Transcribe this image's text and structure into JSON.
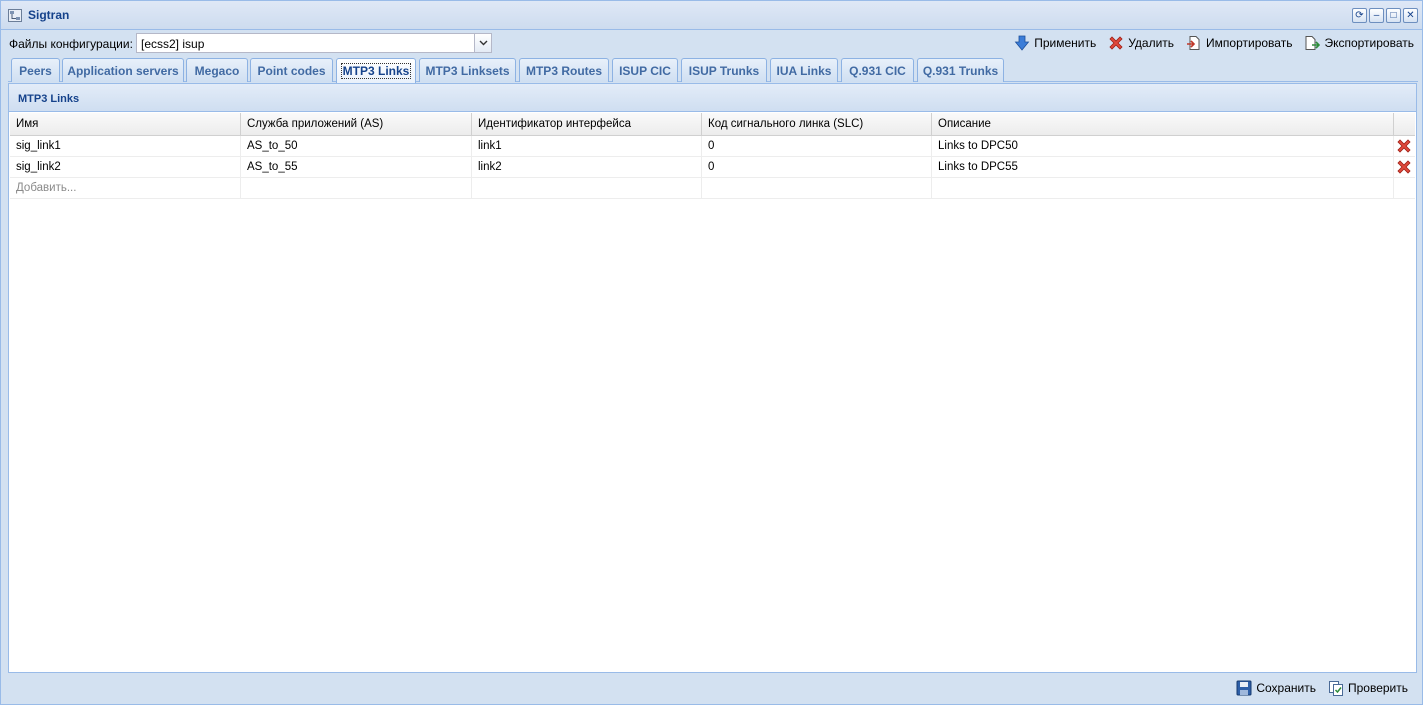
{
  "window": {
    "title": "Sigtran",
    "tools": [
      "refresh-icon",
      "minimize-icon",
      "maximize-icon",
      "close-icon"
    ]
  },
  "toolbar": {
    "config_label": "Файлы конфигурации:",
    "config_value": "[ecss2] isup",
    "apply": "Применить",
    "delete": "Удалить",
    "import": "Импортировать",
    "export": "Экспортировать"
  },
  "tabs": [
    {
      "label": "Peers",
      "active": false
    },
    {
      "label": "Application servers",
      "active": false
    },
    {
      "label": "Megaco",
      "active": false
    },
    {
      "label": "Point codes",
      "active": false
    },
    {
      "label": "MTP3 Links",
      "active": true
    },
    {
      "label": "MTP3 Linksets",
      "active": false
    },
    {
      "label": "MTP3 Routes",
      "active": false
    },
    {
      "label": "ISUP CIC",
      "active": false
    },
    {
      "label": "ISUP Trunks",
      "active": false
    },
    {
      "label": "IUA Links",
      "active": false
    },
    {
      "label": "Q.931 CIC",
      "active": false
    },
    {
      "label": "Q.931 Trunks",
      "active": false
    }
  ],
  "panel": {
    "title": "MTP3 Links",
    "columns": [
      "Имя",
      "Служба приложений (AS)",
      "Идентификатор интерфейса",
      "Код сигнального линка (SLC)",
      "Описание"
    ],
    "rows": [
      [
        "sig_link1",
        "AS_to_50",
        "link1",
        "0",
        "Links to DPC50"
      ],
      [
        "sig_link2",
        "AS_to_55",
        "link2",
        "0",
        "Links to DPC55"
      ]
    ],
    "add_placeholder": "Добавить..."
  },
  "footer": {
    "save": "Сохранить",
    "check": "Проверить"
  },
  "colors": {
    "accent": "#15428b",
    "border": "#99bbe8",
    "background": "#d3e1f1"
  }
}
